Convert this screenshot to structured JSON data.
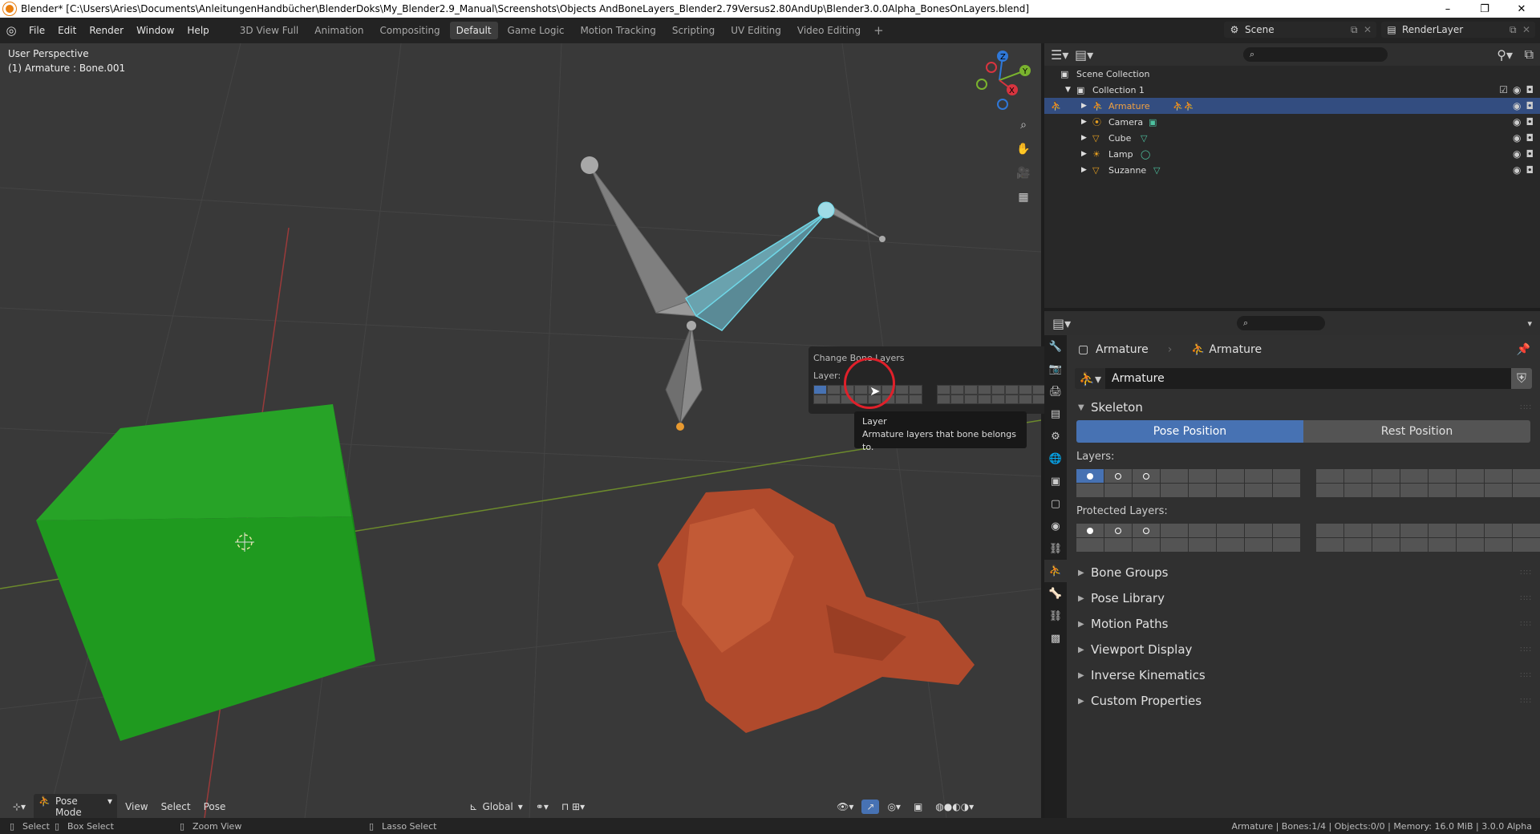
{
  "window": {
    "title": "Blender* [C:\\Users\\Aries\\Documents\\AnleitungenHandbücher\\BlenderDoks\\My_Blender2.9_Manual\\Screenshots\\Objects AndBoneLayers_Blender2.79Versus2.80AndUp\\Blender3.0.0Alpha_BonesOnLayers.blend]",
    "min": "–",
    "max": "❐",
    "close": "✕"
  },
  "menu": [
    "File",
    "Edit",
    "Render",
    "Window",
    "Help"
  ],
  "workspaces": [
    "3D View Full",
    "Animation",
    "Compositing",
    "Default",
    "Game Logic",
    "Motion Tracking",
    "Scripting",
    "UV Editing",
    "Video Editing"
  ],
  "active_workspace": 3,
  "add_workspace": "+",
  "scene": {
    "name": "Scene",
    "view_layer": "RenderLayer"
  },
  "viewport": {
    "view": "User Perspective",
    "active": "(1) Armature : Bone.001"
  },
  "header": {
    "mode": "Pose Mode",
    "view": "View",
    "select": "Select",
    "pose": "Pose",
    "orientation": "Global"
  },
  "gizmo": {
    "z": "Z",
    "y": "Y",
    "x": "X"
  },
  "popup": {
    "title": "Change Bone Layers",
    "layer_label": "Layer:"
  },
  "tooltip": {
    "title": "Layer",
    "desc": "Armature layers that bone belongs to."
  },
  "outliner": {
    "root": "Scene Collection",
    "collection": "Collection 1",
    "items": [
      {
        "name": "Armature",
        "icon_color": "#e8a020"
      },
      {
        "name": "Camera",
        "icon_color": "#e8a020"
      },
      {
        "name": "Cube",
        "icon_color": "#e8a020"
      },
      {
        "name": "Lamp",
        "icon_color": "#e8a020"
      },
      {
        "name": "Suzanne",
        "icon_color": "#e8a020"
      }
    ],
    "selected": 0
  },
  "properties": {
    "breadcrumb_object": "Armature",
    "breadcrumb_data": "Armature",
    "data_name": "Armature",
    "skeleton_title": "Skeleton",
    "pose_position": "Pose Position",
    "rest_position": "Rest Position",
    "layers_label": "Layers:",
    "protected_label": "Protected Layers:",
    "panels": [
      "Bone Groups",
      "Pose Library",
      "Motion Paths",
      "Viewport Display",
      "Inverse Kinematics",
      "Custom Properties"
    ]
  },
  "status": {
    "select": "Select",
    "box_select": "Box Select",
    "zoom_view": "Zoom View",
    "lasso_select": "Lasso Select",
    "stats": "Armature | Bones:1/4 | Objects:0/0 | Memory: 16.0 MiB | 3.0.0 Alpha"
  },
  "colors": {
    "accent": "#4772b3",
    "selected_row": "#334d80",
    "cube": "#1f9a1f",
    "suzanne": "#b04a2c",
    "bone": "#8a8a8a",
    "bone_active": "#5fd0e0"
  }
}
